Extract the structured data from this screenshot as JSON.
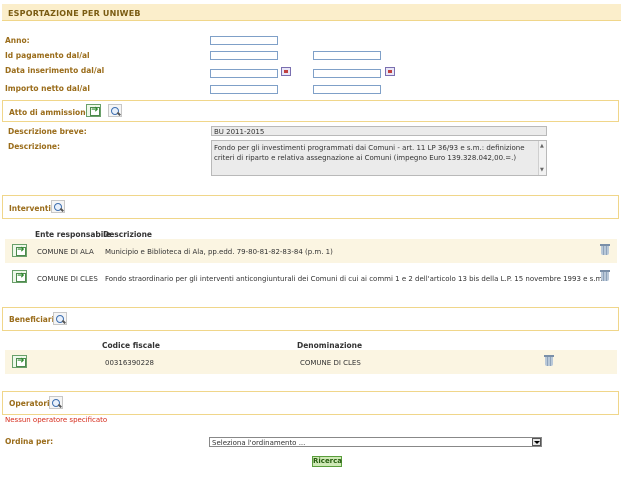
{
  "page_title": "ESPORTAZIONE PER UNIWEB",
  "filters": {
    "anno_label": "Anno:",
    "id_pagamento_label": "Id pagamento dal/al",
    "data_inserimento_label": "Data inserimento dal/al",
    "importo_netto_label": "Importo netto dal/al"
  },
  "atto": {
    "title": "Atto di ammissione",
    "descrizione_breve_label": "Descrizione breve:",
    "descrizione_breve_value": "BU 2011-2015",
    "descrizione_label": "Descrizione:",
    "descrizione_value": "Fondo per gli investimenti programmati dai Comuni - art. 11 LP 36/93 e s.m.: definizione criteri di riparto e relativa assegnazione ai Comuni (impegno Euro 139.328.042,00.=.)"
  },
  "interventi": {
    "title": "Interventi",
    "columns": [
      "Ente responsabile",
      "Descrizione"
    ],
    "rows": [
      {
        "ente": "COMUNE DI ALA",
        "descrizione": "Municipio e Biblioteca di Ala, pp.edd. 79-80-81-82-83-84 (p.m. 1)"
      },
      {
        "ente": "COMUNE DI CLES",
        "descrizione": "Fondo straordinario per gli interventi anticongiunturali dei Comuni di cui ai commi 1 e 2 dell'articolo 13 bis della L.P. 15 novembre 1993 e s.m."
      }
    ]
  },
  "beneficiari": {
    "title": "Beneficiari",
    "columns": [
      "Codice fiscale",
      "Denominazione"
    ],
    "rows": [
      {
        "codice_fiscale": "00316390228",
        "denominazione": "COMUNE DI CLES"
      }
    ]
  },
  "operatori": {
    "title": "Operatori",
    "empty_message": "Nessun operatore specificato"
  },
  "ordina": {
    "label": "Ordina per:",
    "selected": "Seleziona l'ordinamento ..."
  },
  "search_button": "Ricerca",
  "colors": {
    "title_bg": "#fbeecb",
    "label": "#9a6c1a",
    "error": "#d62a1a",
    "button_bg": "#cfe9b6"
  }
}
